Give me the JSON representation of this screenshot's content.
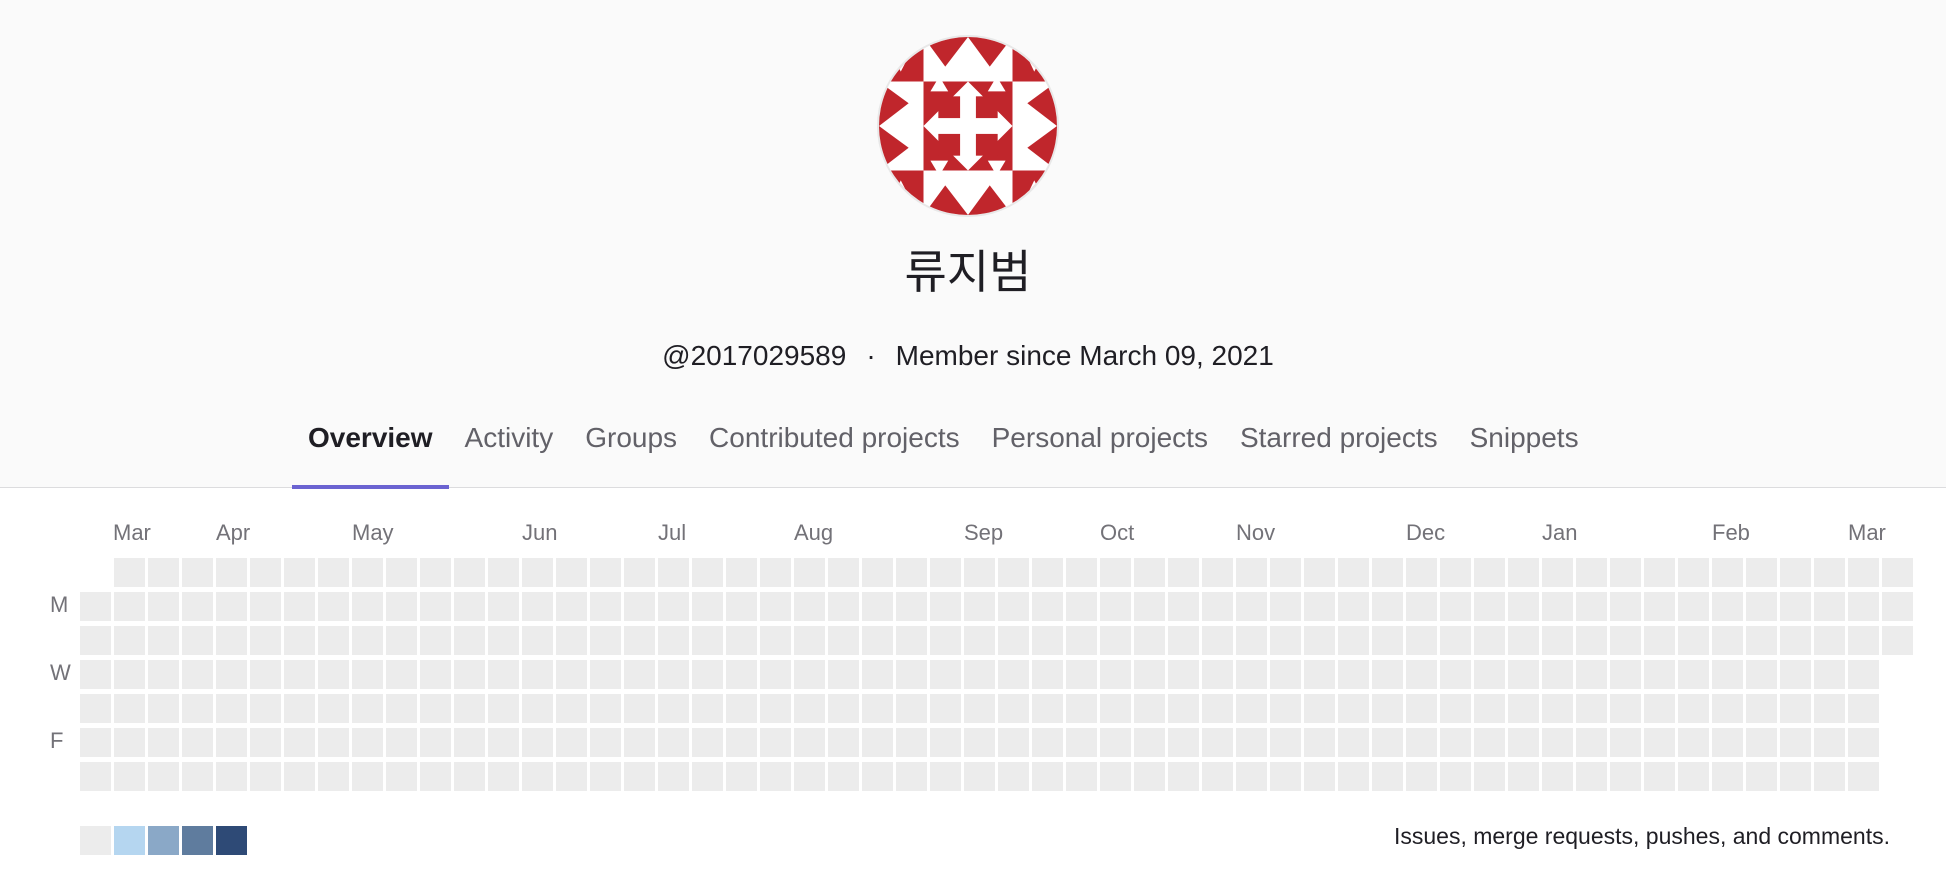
{
  "profile": {
    "name": "류지범",
    "username": "@2017029589",
    "separator": "·",
    "member_since": "Member since March 09, 2021"
  },
  "tabs": [
    {
      "label": "Overview",
      "active": true
    },
    {
      "label": "Activity",
      "active": false
    },
    {
      "label": "Groups",
      "active": false
    },
    {
      "label": "Contributed projects",
      "active": false
    },
    {
      "label": "Personal projects",
      "active": false
    },
    {
      "label": "Starred projects",
      "active": false
    },
    {
      "label": "Snippets",
      "active": false
    }
  ],
  "calendar": {
    "months": [
      "Mar",
      "Apr",
      "May",
      "Jun",
      "Jul",
      "Aug",
      "Sep",
      "Oct",
      "Nov",
      "Dec",
      "Jan",
      "Feb",
      "Mar"
    ],
    "day_labels": [
      "M",
      "W",
      "F"
    ],
    "legend_colors": [
      "#ececec",
      "#b5d6f0",
      "#8aa8c7",
      "#5f7c9e",
      "#2e4a76"
    ],
    "legend_text": "Issues, merge requests, pushes, and comments.",
    "contributions": 0
  },
  "colors": {
    "avatar": "#c0262c",
    "active_tab_underline": "#6b63d1",
    "empty_cell": "#ececec"
  }
}
